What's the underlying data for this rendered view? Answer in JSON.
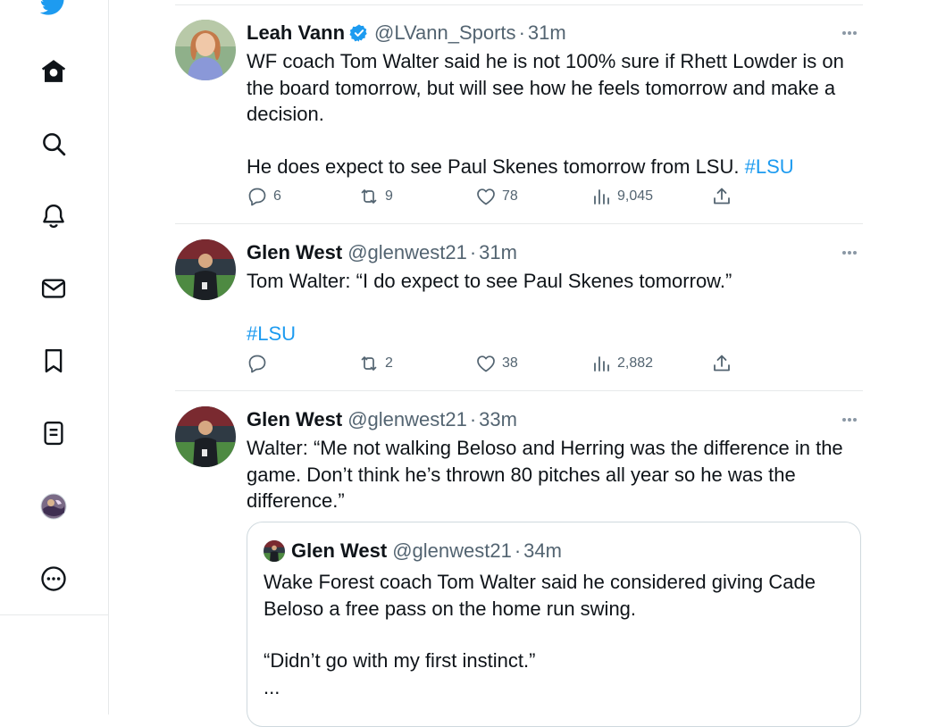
{
  "nav": {
    "items": [
      {
        "icon": "twitter-bird-icon"
      },
      {
        "icon": "home-icon"
      },
      {
        "icon": "search-icon"
      },
      {
        "icon": "notifications-bell-icon"
      },
      {
        "icon": "messages-envelope-icon"
      },
      {
        "icon": "bookmark-icon"
      },
      {
        "icon": "lists-icon"
      },
      {
        "icon": "profile-avatar-icon"
      },
      {
        "icon": "more-options-icon"
      }
    ]
  },
  "colors": {
    "accent": "#1d9bf0",
    "text": "#0f1419",
    "muted": "#536471",
    "border": "#e7e9ea"
  },
  "tweets": [
    {
      "name": "Leah Vann",
      "verified": true,
      "handle": "@LVann_Sports",
      "time": "31m",
      "body1": "WF coach Tom Walter said he is not 100% sure if Rhett Lowder is on the board tomorrow, but will see how he feels tomorrow and make a decision.",
      "body2": "He does expect to see Paul Skenes tomorrow from LSU.",
      "hashtag": "#LSU",
      "replies": "6",
      "retweets": "9",
      "likes": "78",
      "views": "9,045"
    },
    {
      "name": "Glen West",
      "handle": "@glenwest21",
      "time": "31m",
      "body1": "Tom Walter: “I do expect to see Paul Skenes tomorrow.”",
      "hashtag": "#LSU",
      "replies": "",
      "retweets": "2",
      "likes": "38",
      "views": "2,882"
    },
    {
      "name": "Glen West",
      "handle": "@glenwest21",
      "time": "33m",
      "body1": "Walter: “Me not walking Beloso and Herring was the difference in the game. Don’t think he’s thrown 80 pitches all year so he was the difference.”",
      "quote": {
        "name": "Glen West",
        "handle": "@glenwest21",
        "time": "34m",
        "body1": "Wake Forest coach Tom Walter said he considered giving Cade Beloso a free pass on the home run swing.",
        "body2": "“Didn’t go with my first instinct.”",
        "body3": "..."
      }
    }
  ]
}
